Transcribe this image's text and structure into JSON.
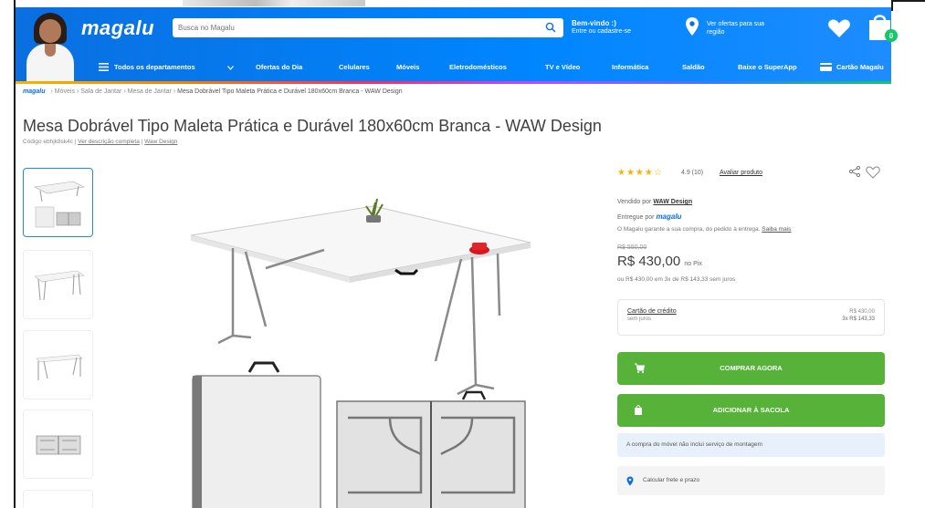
{
  "header": {
    "logo": "magalu",
    "search_placeholder": "Busca no Magalu",
    "welcome_line1": "Bem-vindo :)",
    "welcome_line2": "Entre ou cadastre-se",
    "location_text": "Ver ofertas para sua região"
  },
  "nav": {
    "items": [
      "Todos os departamentos",
      "Ofertas do Dia",
      "Celulares",
      "Móveis",
      "Eletrodomésticos",
      "TV e Vídeo",
      "Informática",
      "Saldão",
      "Baixe o SuperApp",
      "Cartão Magalu"
    ]
  },
  "breadcrumb": {
    "brand": "magalu",
    "items": [
      "Móveis",
      "Sala de Jantar",
      "Mesa de Jantar"
    ],
    "current": "Mesa Dobrável Tipo Maleta Prática e Durável 180x60cm Branca - WAW Design"
  },
  "product": {
    "title": "Mesa Dobrável Tipo Maleta Prática e Durável 180x60cm Branca - WAW Design",
    "code": "Código ebhjk8sk4c",
    "desc_link": "Ver descrição completa",
    "brand_link": "Waw Design"
  },
  "buybox": {
    "stars": "★★★★☆",
    "rating": "4.9 (10)",
    "rate_link": "Avaliar produto",
    "seller_prefix": "Vendido por",
    "seller": "WAW Design",
    "deliv_prefix": "Entregue por",
    "deliv_brand": "magalu",
    "guarantee": "O Magalu garante a sua compra, do pedido à entrega.",
    "guarantee_link": "Saiba mais",
    "old_price": "R$ 550,00",
    "price": "R$ 430,00",
    "price_suffix": "no Pix",
    "installments": "ou R$ 430,00 em 3x de R$ 143,33 sem juros",
    "card_label": "Cartão de crédito",
    "card_sub": "sem juros",
    "card_v1": "R$ 430,00",
    "card_v2": "3x R$ 143,33",
    "buy_now": "COMPRAR AGORA",
    "add_bag": "ADICIONAR À SACOLA",
    "note": "A compra do móvel não inclui serviço de montagem",
    "freight": "Calcular frete e prazo"
  }
}
